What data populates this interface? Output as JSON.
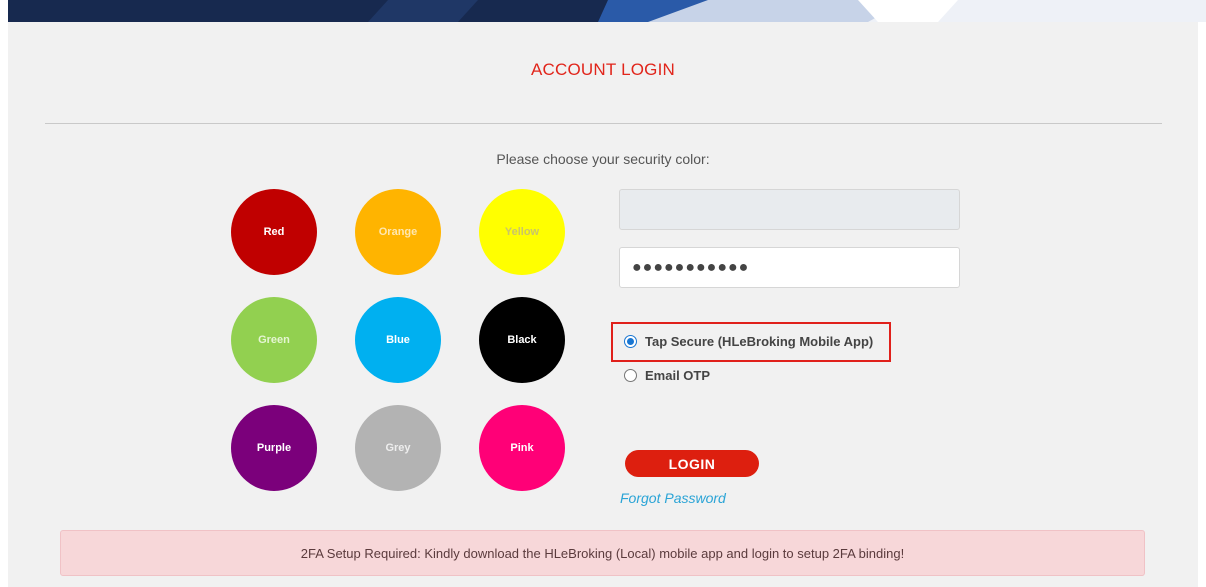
{
  "header": {
    "title": "ACCOUNT LOGIN"
  },
  "security": {
    "prompt": "Please choose your security color:",
    "colors": [
      {
        "label": "Red",
        "fill": "#c00000",
        "text": "#ffffff"
      },
      {
        "label": "Orange",
        "fill": "#ffb400",
        "text": "#ffe7b0"
      },
      {
        "label": "Yellow",
        "fill": "#ffff00",
        "text": "#c9c46a"
      },
      {
        "label": "Green",
        "fill": "#92d050",
        "text": "#e5f5d3"
      },
      {
        "label": "Blue",
        "fill": "#00b0f0",
        "text": "#ffffff"
      },
      {
        "label": "Black",
        "fill": "#000000",
        "text": "#ffffff"
      },
      {
        "label": "Purple",
        "fill": "#7b007b",
        "text": "#ffffff"
      },
      {
        "label": "Grey",
        "fill": "#b3b3b3",
        "text": "#eeeeee"
      },
      {
        "label": "Pink",
        "fill": "#ff0077",
        "text": "#ffffff"
      }
    ]
  },
  "form": {
    "username_value": "",
    "password_value": "●●●●●●●●●●●",
    "auth_options": [
      {
        "label": "Tap Secure (HLeBroking Mobile App)",
        "selected": true
      },
      {
        "label": "Email OTP",
        "selected": false
      }
    ],
    "login_label": "LOGIN",
    "forgot_label": "Forgot Password"
  },
  "alert": {
    "message": "2FA Setup Required: Kindly download the HLeBroking (Local) mobile app and login to setup 2FA binding!"
  },
  "theme": {
    "accent_red": "#e1251b",
    "link_blue": "#2aa4d6",
    "radio_blue": "#1976d2",
    "banner_navy": "#17294f"
  }
}
